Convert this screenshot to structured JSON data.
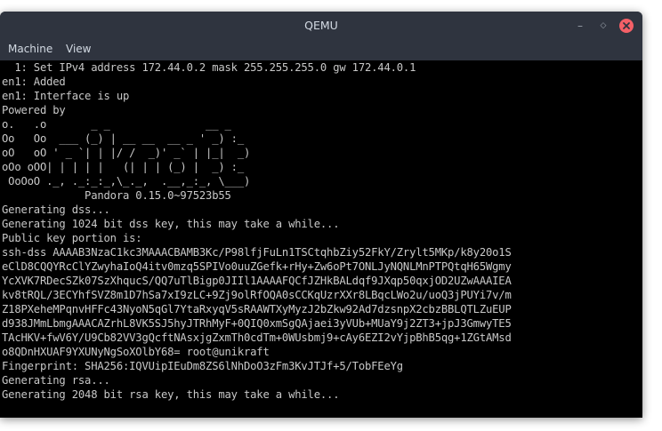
{
  "window": {
    "title": "QEMU",
    "minimize_glyph": "–",
    "maximize_glyph": "◇",
    "close_glyph": "×"
  },
  "menu": {
    "items": [
      "Machine",
      "View"
    ]
  },
  "console": {
    "lines": [
      "  1: Set IPv4 address 172.44.0.2 mask 255.255.255.0 gw 172.44.0.1",
      "en1: Added",
      "en1: Interface is up",
      "Powered by",
      "o.   .o       _ _               __ _",
      "Oo   Oo  ___ (_) | __ __  __ _ ' _) :_",
      "oO   oO ' _ `| | |/ /  _)' _` | |_|  _)",
      "oOo oOO| | | | |   (| | | (_) |  _) :_",
      " OoOoO ._, ._:_:_,\\_._,  .__,_:_, \\___)",
      "             Pandora 0.15.0~97523b55",
      "Generating dss...",
      "Generating 1024 bit dss key, this may take a while...",
      "Public key portion is:",
      "ssh-dss AAAAB3NzaC1kc3MAAACBAMB3Kc/P98lfjFuLn1TSCtqhbZiy52FkY/Zrylt5MKp/k8y20o1S",
      "eClD8CQQYRcClYZwyhaIoQ4itv0mzq5SPIVo0uuZGefk+rHy+Zw6oPt7ONLJyNQNLMnPTPQtqH65Wgmy",
      "YcXVK7RDecSZk07SzXhqucS/QQ7uTlBigp0JIIl1AAAAFQCfJZHkBALdqf9JXqp50qxjOD2UZwAAAIEA",
      "kv8tRQL/3ECYhfSVZ8m1D7hSa7xI9zLC+9Zj9olRfOQA0sCCKqUzrXXr8LBqcLWo2u/uoQ3jPUYi7v/m",
      "Z18PXeheMPqnvHFFc43NyoN5qGl7YtaRxyqV5sRAAWTXyMyzJ2bZkw92Ad7dzsnpX2cbzBBLQTLZuEUP",
      "d938JMmLbmgAAACAZrhL8VK5SJ5hyJTRhMyF+0QIQ0xmSgQAjaei3yVUb+MUaY9j2ZT3+jpJ3GmwyTE5",
      "TAcHKV+fwV6Y/U9Cb82VV3gQcftNAsxjgZxmTh0cdTm+0WUsbmj9+cAy6EZI2vYjpBhB5qg+1ZGtAMsd",
      "o8QDnHXUAF9YXUNyNgSoXOlbY68= root@unikraft",
      "Fingerprint: SHA256:IQVUipIEuDm8ZS6lNhDoO3zFm3KvJTJf+5/TobFEeYg",
      "Generating rsa...",
      "Generating 2048 bit rsa key, this may take a while..."
    ]
  }
}
